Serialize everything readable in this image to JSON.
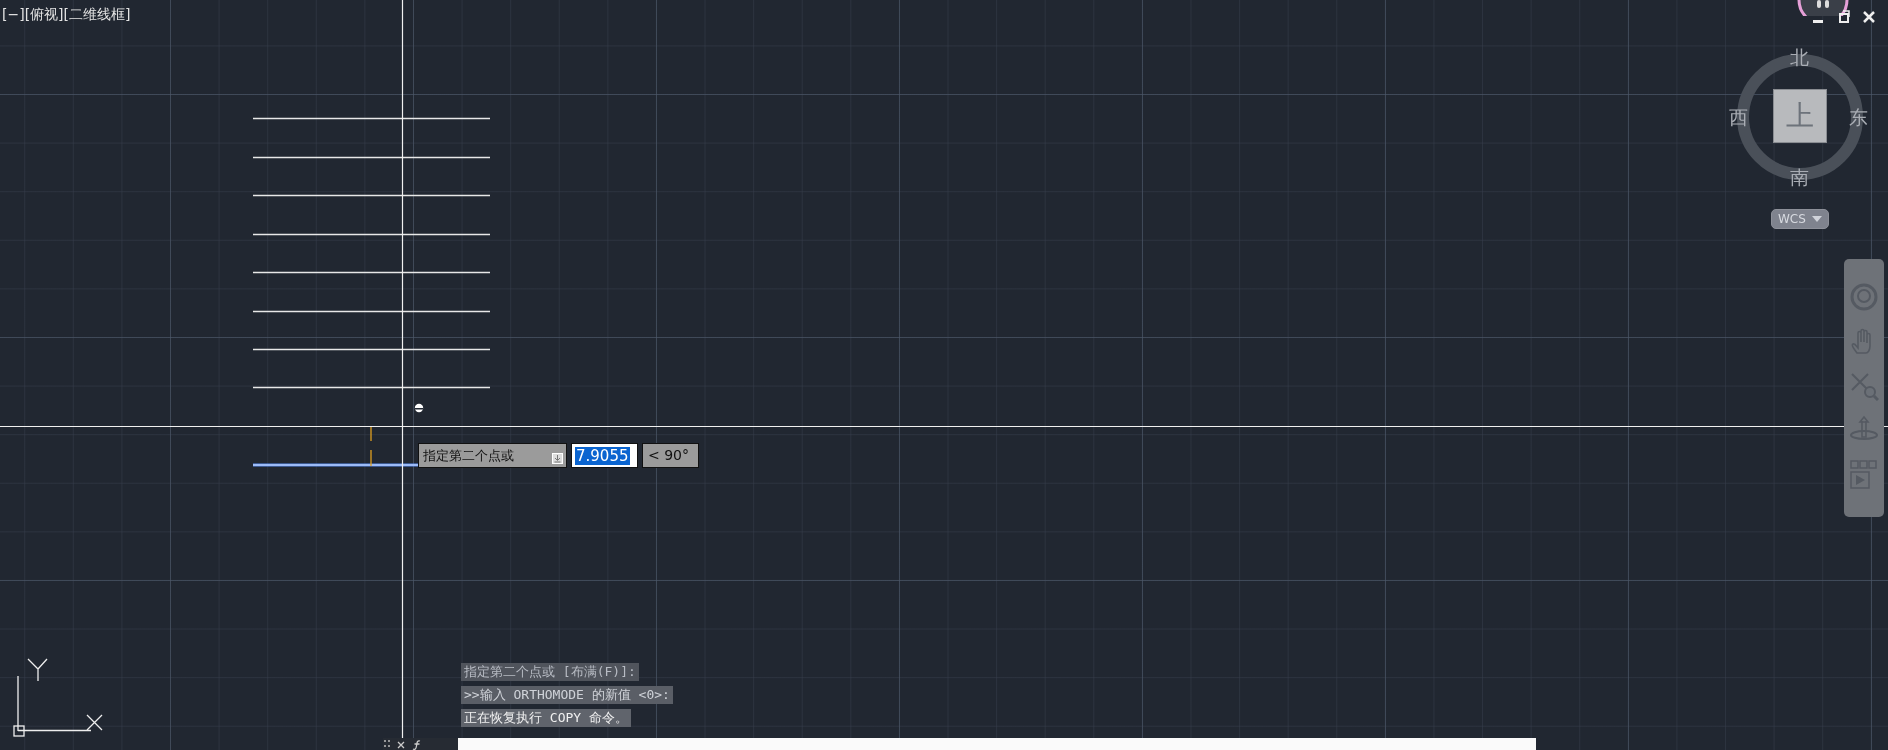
{
  "viewport_label": "[−][俯视][二维线框]",
  "viewcube": {
    "north": "北",
    "south": "南",
    "west": "西",
    "east": "东",
    "face": "上",
    "coordinate_system": "WCS"
  },
  "dynamic_input": {
    "prompt": "指定第二个点或",
    "value": "7.9055",
    "value_selected": true,
    "angle": "< 90°"
  },
  "command_history": [
    "指定第二个点或 [布满(F)]:",
    ">>输入 ORTHOMODE 的新值 <0>:",
    "正在恢复执行 COPY 命令。"
  ]
}
